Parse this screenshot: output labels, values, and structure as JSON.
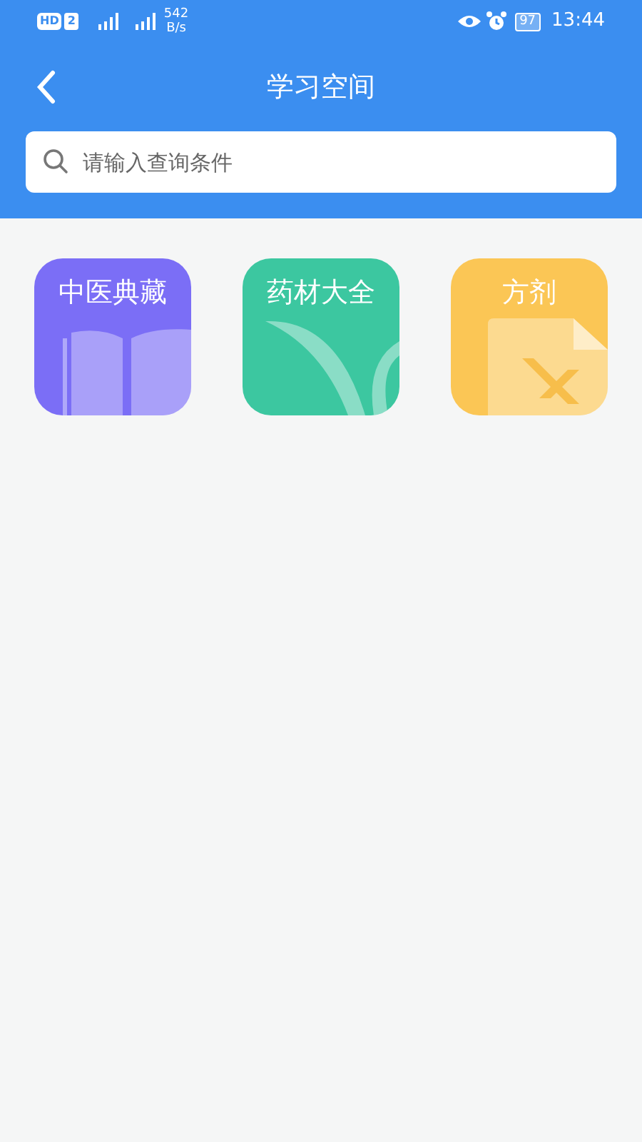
{
  "status_bar": {
    "hd": "HD",
    "sim": "2",
    "speed_value": "542",
    "speed_unit": "B/s",
    "battery": "97",
    "time": "13:44"
  },
  "header": {
    "title": "学习空间"
  },
  "search": {
    "placeholder": "请输入查询条件"
  },
  "tiles": [
    {
      "label": "中医典藏",
      "kind": "book",
      "color": "#7b6ef6"
    },
    {
      "label": "药材大全",
      "kind": "leaf",
      "color": "#3cc7a0"
    },
    {
      "label": "方剂",
      "kind": "prescription",
      "color": "#fbc655"
    }
  ]
}
